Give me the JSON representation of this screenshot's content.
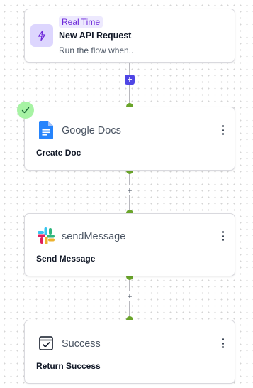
{
  "colors": {
    "accent": "#4f46e5",
    "connector_dot": "#6aa52a",
    "success_check": "#a7f3a4",
    "badge_bg": "#ede9fe",
    "badge_text": "#6d28d9"
  },
  "trigger": {
    "badge": "Real Time",
    "title": "New API Request",
    "subtitle": "Run the flow when..",
    "icon": "lightning-bolt-icon"
  },
  "connectors": {
    "add_main": "+",
    "add_between": "+"
  },
  "steps": [
    {
      "name": "Google Docs",
      "action": "Create Doc",
      "icon": "google-docs-icon",
      "status": "completed",
      "status_icon": "checkmark-icon"
    },
    {
      "name": "sendMessage",
      "action": "Send Message",
      "icon": "slack-icon"
    },
    {
      "name": "Success",
      "action": "Return Success",
      "icon": "success-checkbox-icon"
    }
  ]
}
